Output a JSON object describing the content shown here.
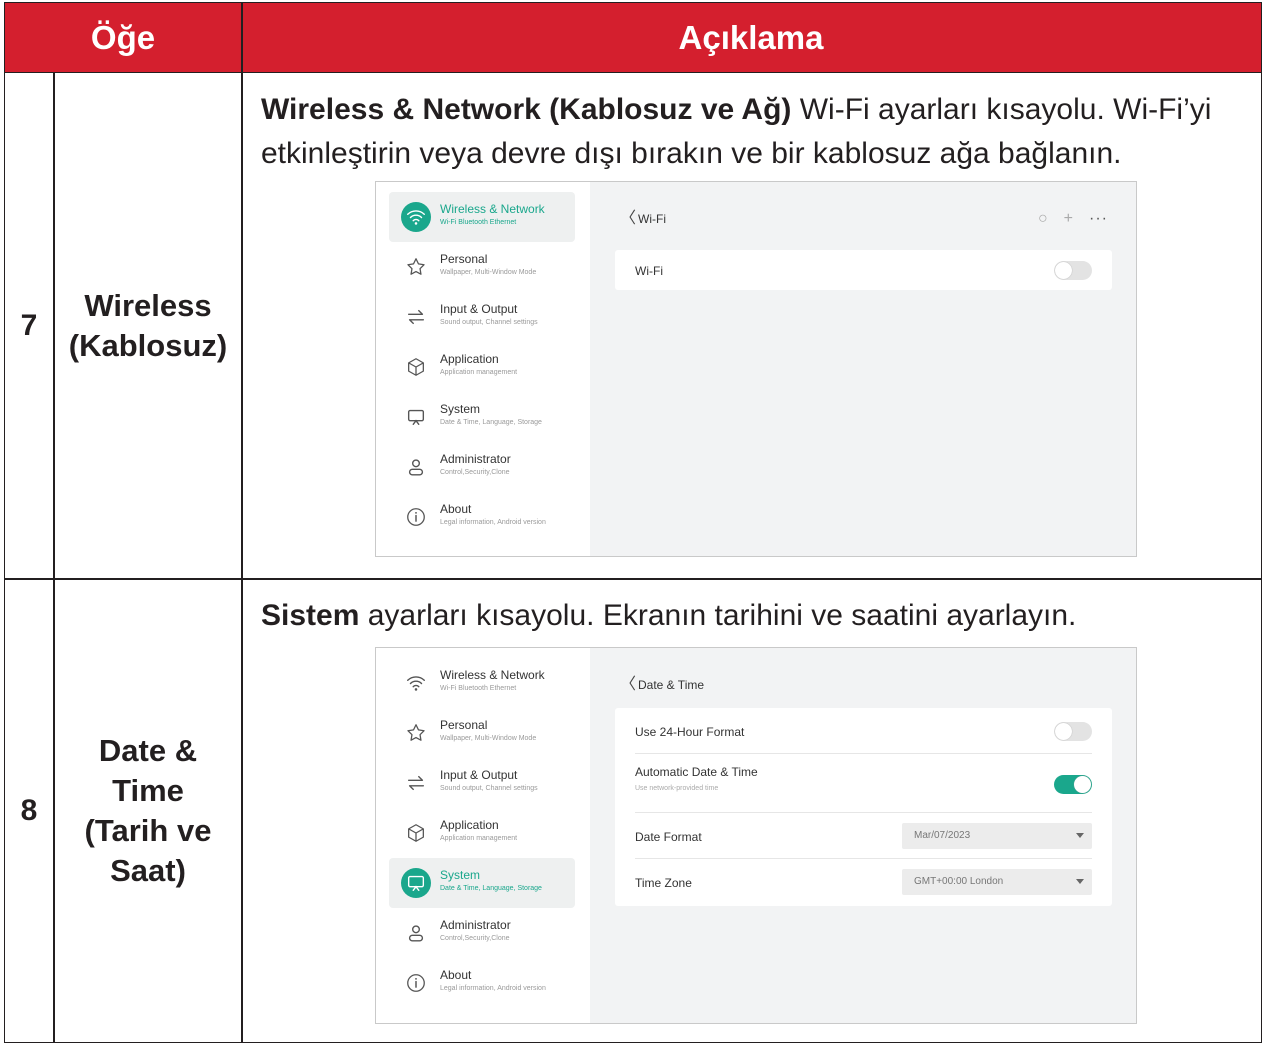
{
  "table": {
    "header_item": "Öğe",
    "header_desc": "Açıklama"
  },
  "rows": [
    {
      "number": "7",
      "item": "Wireless (Kablosuz)",
      "desc_bold": "Wireless & Network (Kablosuz ve Ağ)",
      "desc_rest": " Wi-Fi ayarları kısayolu. Wi-Fi’yi etkinleştirin veya devre dışı bırakın ve bir kablosuz ağa bağlanın."
    },
    {
      "number": "8",
      "item_lines": [
        "Date &",
        "Time",
        "(Tarih ve",
        "Saat)"
      ],
      "desc_bold": "Sistem",
      "desc_rest": " ayarları kısayolu. Ekranın tarihini ve saatini ayarlayın."
    }
  ],
  "nav": [
    {
      "title": "Wireless & Network",
      "sub": "Wi-Fi Bluetooth Ethernet",
      "icon": "wifi-icon"
    },
    {
      "title": "Personal",
      "sub": "Wallpaper, Multi-Window Mode",
      "icon": "star-icon"
    },
    {
      "title": "Input & Output",
      "sub": "Sound output, Channel settings",
      "icon": "swap-arrows-icon"
    },
    {
      "title": "Application",
      "sub": "Application management",
      "icon": "cube-icon"
    },
    {
      "title": "System",
      "sub": "Date & Time, Language, Storage",
      "icon": "monitor-icon"
    },
    {
      "title": "Administrator",
      "sub": "Control,Security,Clone",
      "icon": "user-icon"
    },
    {
      "title": "About",
      "sub": "Legal information, Android version",
      "icon": "info-icon"
    }
  ],
  "screen1": {
    "active_nav": 0,
    "page_title": "Wi-Fi",
    "tools": [
      "refresh-icon",
      "plus-icon",
      "more-icon"
    ],
    "wifi_label": "Wi-Fi",
    "wifi_on": false
  },
  "screen2": {
    "active_nav": 4,
    "page_title": "Date & Time",
    "use24_label": "Use 24-Hour Format",
    "use24_on": false,
    "auto_label": "Automatic Date & Time",
    "auto_sub": "Use network-provided time",
    "auto_on": true,
    "date_format_label": "Date Format",
    "date_format_value": "Mar/07/2023",
    "timezone_label": "Time Zone",
    "timezone_value": "GMT+00:00 London"
  },
  "colors": {
    "header_red": "#d41f2e",
    "accent_teal": "#1aa78c"
  }
}
